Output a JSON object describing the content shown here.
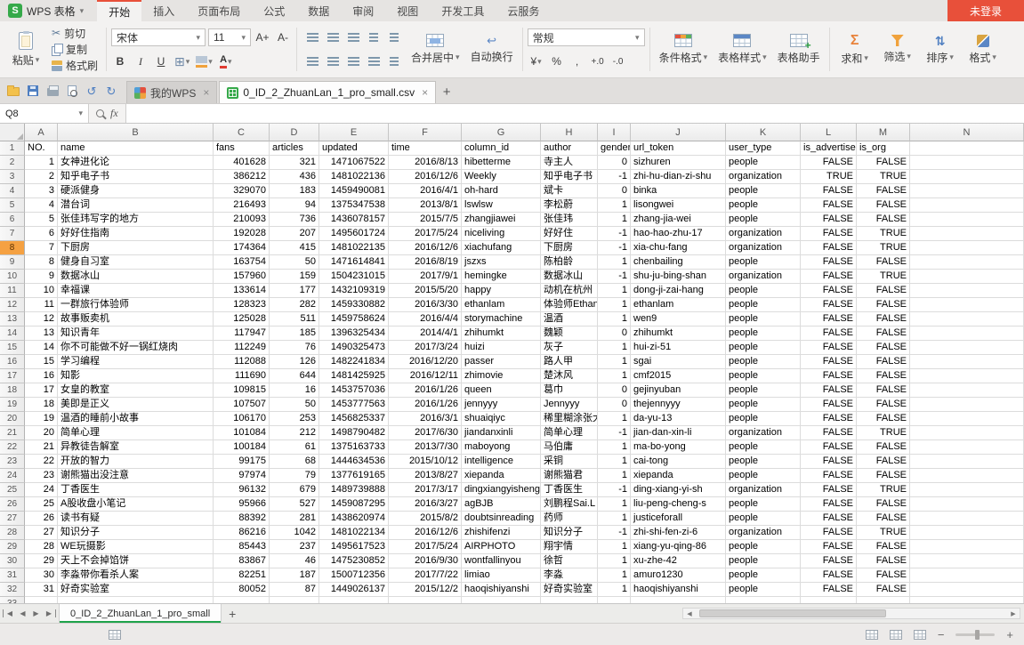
{
  "titlebar": {
    "app_name": "WPS 表格",
    "login": "未登录",
    "tabs": [
      {
        "label": "开始",
        "active": true
      },
      {
        "label": "插入"
      },
      {
        "label": "页面布局"
      },
      {
        "label": "公式"
      },
      {
        "label": "数据"
      },
      {
        "label": "审阅"
      },
      {
        "label": "视图"
      },
      {
        "label": "开发工具"
      },
      {
        "label": "云服务"
      }
    ]
  },
  "ribbon": {
    "paste": "粘贴",
    "cut": "剪切",
    "copy": "复制",
    "format_painter": "格式刷",
    "font_name": "宋体",
    "font_size": "11",
    "grow_font": "A+",
    "shrink_font": "A-",
    "bold": "B",
    "italic": "I",
    "underline": "U",
    "merge_center": "合并居中",
    "wrap_text": "自动换行",
    "number_format": "常规",
    "conditional_format": "条件格式",
    "table_style": "表格样式",
    "table_helper": "表格助手",
    "sum": "求和",
    "filter": "筛选",
    "sort": "排序",
    "format": "格式"
  },
  "docbar": {
    "tabs": [
      {
        "label": "我的WPS"
      },
      {
        "label": "0_ID_2_ZhuanLan_1_pro_small.csv",
        "active": true
      }
    ]
  },
  "formula_bar": {
    "name_box": "Q8",
    "fx": "fx"
  },
  "sheet": {
    "selected_row": 8,
    "column_letters": [
      "A",
      "B",
      "C",
      "D",
      "E",
      "F",
      "G",
      "H",
      "I",
      "J",
      "K",
      "L",
      "M",
      "N"
    ],
    "header_row": [
      "NO.",
      "name",
      "fans",
      "articles",
      "updated",
      "time",
      "column_id",
      "author",
      "gender",
      "url_token",
      "user_type",
      "is_advertise",
      "is_org",
      ""
    ],
    "rows": [
      [
        "1",
        "女神进化论",
        "401628",
        "321",
        "1471067522",
        "2016/8/13",
        "hibetterme",
        "寺主人",
        "0",
        "sizhuren",
        "people",
        "FALSE",
        "FALSE"
      ],
      [
        "2",
        "知乎电子书",
        "386212",
        "436",
        "1481022136",
        "2016/12/6",
        "Weekly",
        "知乎电子书",
        "-1",
        "zhi-hu-dian-zi-shu",
        "organization",
        "TRUE",
        "TRUE"
      ],
      [
        "3",
        "硬派健身",
        "329070",
        "183",
        "1459490081",
        "2016/4/1",
        "oh-hard",
        "斌卡",
        "0",
        "binka",
        "people",
        "FALSE",
        "FALSE"
      ],
      [
        "4",
        "潜台词",
        "216493",
        "94",
        "1375347538",
        "2013/8/1",
        "lswlsw",
        "李松蔚",
        "1",
        "lisongwei",
        "people",
        "FALSE",
        "FALSE"
      ],
      [
        "5",
        "张佳玮写字的地方",
        "210093",
        "736",
        "1436078157",
        "2015/7/5",
        "zhangjiawei",
        "张佳玮",
        "1",
        "zhang-jia-wei",
        "people",
        "FALSE",
        "FALSE"
      ],
      [
        "6",
        "好好住指南",
        "192028",
        "207",
        "1495601724",
        "2017/5/24",
        "niceliving",
        "好好住",
        "-1",
        "hao-hao-zhu-17",
        "organization",
        "FALSE",
        "TRUE"
      ],
      [
        "7",
        "下厨房",
        "174364",
        "415",
        "1481022135",
        "2016/12/6",
        "xiachufang",
        "下厨房",
        "-1",
        "xia-chu-fang",
        "organization",
        "FALSE",
        "TRUE"
      ],
      [
        "8",
        "健身自习室",
        "163754",
        "50",
        "1471614841",
        "2016/8/19",
        "jszxs",
        "陈柏龄",
        "1",
        "chenbailing",
        "people",
        "FALSE",
        "FALSE"
      ],
      [
        "9",
        "数据冰山",
        "157960",
        "159",
        "1504231015",
        "2017/9/1",
        "hemingke",
        "数据冰山",
        "-1",
        "shu-ju-bing-shan",
        "organization",
        "FALSE",
        "TRUE"
      ],
      [
        "10",
        "幸福课",
        "133614",
        "177",
        "1432109319",
        "2015/5/20",
        "happy",
        "动机在杭州",
        "1",
        "dong-ji-zai-hang",
        "people",
        "FALSE",
        "FALSE"
      ],
      [
        "11",
        "一群旅行体验师",
        "128323",
        "282",
        "1459330882",
        "2016/3/30",
        "ethanlam",
        "体验师Ethan",
        "1",
        "ethanlam",
        "people",
        "FALSE",
        "FALSE"
      ],
      [
        "12",
        "故事贩卖机",
        "125028",
        "511",
        "1459758624",
        "2016/4/4",
        "storymachine",
        "温酒",
        "1",
        "wen9",
        "people",
        "FALSE",
        "FALSE"
      ],
      [
        "13",
        "知识青年",
        "117947",
        "185",
        "1396325434",
        "2014/4/1",
        "zhihumkt",
        "魏颖",
        "0",
        "zhihumkt",
        "people",
        "FALSE",
        "FALSE"
      ],
      [
        "14",
        "你不可能做不好一锅红烧肉",
        "112249",
        "76",
        "1490325473",
        "2017/3/24",
        "huizi",
        "灰子",
        "1",
        "hui-zi-51",
        "people",
        "FALSE",
        "FALSE"
      ],
      [
        "15",
        "学习编程",
        "112088",
        "126",
        "1482241834",
        "2016/12/20",
        "passer",
        "路人甲",
        "1",
        "sgai",
        "people",
        "FALSE",
        "FALSE"
      ],
      [
        "16",
        "知影",
        "111690",
        "644",
        "1481425925",
        "2016/12/11",
        "zhimovie",
        "楚沐风",
        "1",
        "cmf2015",
        "people",
        "FALSE",
        "FALSE"
      ],
      [
        "17",
        "女皇的教室",
        "109815",
        "16",
        "1453757036",
        "2016/1/26",
        "queen",
        "葛巾",
        "0",
        "gejinyuban",
        "people",
        "FALSE",
        "FALSE"
      ],
      [
        "18",
        "美即是正义",
        "107507",
        "50",
        "1453777563",
        "2016/1/26",
        "jennyyy",
        "Jennyyy",
        "0",
        "thejennyyy",
        "people",
        "FALSE",
        "FALSE"
      ],
      [
        "19",
        "温酒的睡前小故事",
        "106170",
        "253",
        "1456825337",
        "2016/3/1",
        "shuaiqiyc",
        "稀里糊涂张大鱼",
        "1",
        "da-yu-13",
        "people",
        "FALSE",
        "FALSE"
      ],
      [
        "20",
        "简单心理",
        "101084",
        "212",
        "1498790482",
        "2017/6/30",
        "jiandanxinli",
        "简单心理",
        "-1",
        "jian-dan-xin-li",
        "organization",
        "FALSE",
        "TRUE"
      ],
      [
        "21",
        "异教徒告解室",
        "100184",
        "61",
        "1375163733",
        "2013/7/30",
        "maboyong",
        "马伯庸",
        "1",
        "ma-bo-yong",
        "people",
        "FALSE",
        "FALSE"
      ],
      [
        "22",
        "开放的智力",
        "99175",
        "68",
        "1444634536",
        "2015/10/12",
        "intelligence",
        "采铜",
        "1",
        "cai-tong",
        "people",
        "FALSE",
        "FALSE"
      ],
      [
        "23",
        "谢熊猫出没注意",
        "97974",
        "79",
        "1377619165",
        "2013/8/27",
        "xiepanda",
        "谢熊猫君",
        "1",
        "xiepanda",
        "people",
        "FALSE",
        "FALSE"
      ],
      [
        "24",
        "丁香医生",
        "96132",
        "679",
        "1489739888",
        "2017/3/17",
        "dingxiangyisheng",
        "丁香医生",
        "-1",
        "ding-xiang-yi-sh",
        "organization",
        "FALSE",
        "TRUE"
      ],
      [
        "25",
        "A股收盘小笔记",
        "95966",
        "527",
        "1459087295",
        "2016/3/27",
        "agBJB",
        "刘鹏程Sai.L",
        "1",
        "liu-peng-cheng-s",
        "people",
        "FALSE",
        "FALSE"
      ],
      [
        "26",
        "读书有疑",
        "88392",
        "281",
        "1438620974",
        "2015/8/2",
        "doubtsinreading",
        "药师",
        "1",
        "justiceforall",
        "people",
        "FALSE",
        "FALSE"
      ],
      [
        "27",
        "知识分子",
        "86216",
        "1042",
        "1481022134",
        "2016/12/6",
        "zhishifenzi",
        "知识分子",
        "-1",
        "zhi-shi-fen-zi-6",
        "organization",
        "FALSE",
        "TRUE"
      ],
      [
        "28",
        "WE玩摄影",
        "85443",
        "237",
        "1495617523",
        "2017/5/24",
        "AIRPHOTO",
        "翔宇情",
        "1",
        "xiang-yu-qing-86",
        "people",
        "FALSE",
        "FALSE"
      ],
      [
        "29",
        "天上不会掉馅饼",
        "83867",
        "46",
        "1475230852",
        "2016/9/30",
        "wontfallinyou",
        "徐哲",
        "1",
        "xu-zhe-42",
        "people",
        "FALSE",
        "FALSE"
      ],
      [
        "30",
        "李淼带你看杀人案",
        "82251",
        "187",
        "1500712356",
        "2017/7/22",
        "limiao",
        "李淼",
        "1",
        "amuro1230",
        "people",
        "FALSE",
        "FALSE"
      ],
      [
        "31",
        "好奇实验室",
        "80052",
        "87",
        "1449026137",
        "2015/12/2",
        "haoqishiyanshi",
        "好奇实验室",
        "1",
        "haoqishiyanshi",
        "people",
        "FALSE",
        "FALSE"
      ]
    ]
  },
  "sheet_tabs": {
    "active": "0_ID_2_ZhuanLan_1_pro_small"
  },
  "icons": {
    "logo_glyph": "S",
    "caret": "▾",
    "close": "×",
    "add_tab": "+",
    "scissors": "✂",
    "undo": "↺",
    "redo": "↻",
    "borders": "⊞",
    "wrap_arrow": "↩",
    "sum_sigma": "Σ",
    "sort_arrows": "⇅",
    "font_color_letter": "A",
    "currency": "¥",
    "percent": "%",
    "comma": ",",
    "inc_decimal": "+.0",
    "dec_decimal": "-.0",
    "nav_prev": "◀",
    "nav_next": "▶",
    "zoom_out": "−",
    "zoom_in": "+"
  },
  "colors": {
    "brand_green": "#35a949",
    "accent_red": "#e8503a",
    "org_highlight_green": "#92d050",
    "active_sheet_tab_green": "#1fa34b",
    "selected_row_header_orange": "#f5a142"
  }
}
